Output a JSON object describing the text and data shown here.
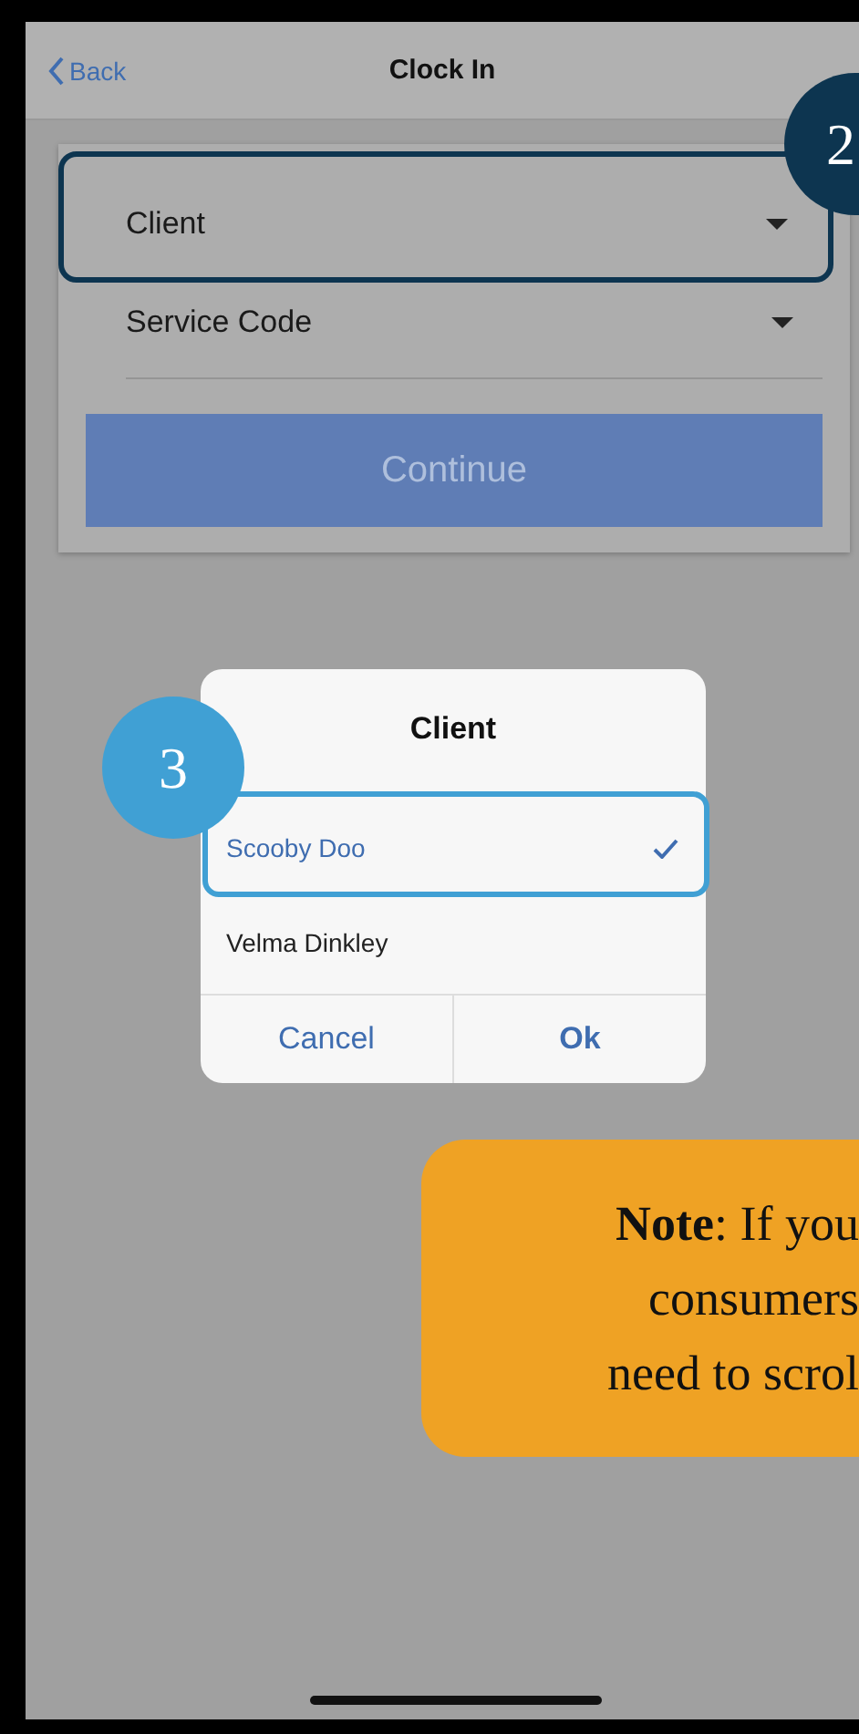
{
  "header": {
    "back": "Back",
    "title": "Clock In"
  },
  "fields": [
    {
      "label": "Client"
    },
    {
      "label": "Service Code"
    }
  ],
  "continue_button": "Continue",
  "dialog": {
    "title": "Client",
    "options": [
      {
        "label": "Scooby Doo",
        "selected": true
      },
      {
        "label": "Velma Dinkley",
        "selected": false
      }
    ],
    "buttons": [
      "Cancel",
      "Ok"
    ]
  },
  "callouts": [
    {
      "number": "2",
      "color": "#0d3550"
    },
    {
      "number": "3",
      "color": "#40a0d4"
    }
  ],
  "note": {
    "lines": [
      "**Note**: If you",
      "consumers",
      "need to scrol"
    ]
  }
}
